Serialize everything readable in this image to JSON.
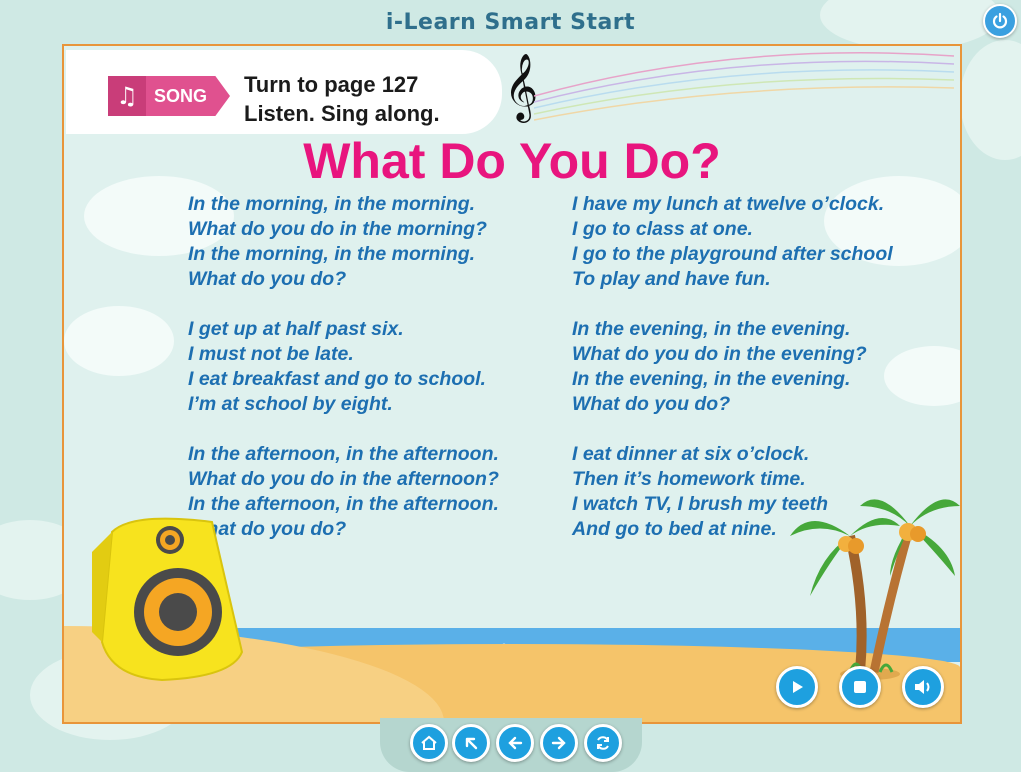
{
  "app": {
    "title": "i-Learn Smart Start"
  },
  "banner": {
    "tag_label": "SONG",
    "instruction_line1": "Turn to page 127",
    "instruction_line2": "Listen. Sing along."
  },
  "song": {
    "title": "What Do You Do?",
    "left_column": [
      [
        "In the morning, in the morning.",
        "What do you do in the morning?",
        "In the morning, in the morning.",
        "What do you do?"
      ],
      [
        "I get up at half past six.",
        "I must not be late.",
        "I eat breakfast and go to school.",
        "I’m at school by eight."
      ],
      [
        "In the afternoon, in the afternoon.",
        "What do you do in the afternoon?",
        "In the afternoon, in the afternoon.",
        "What do you do?"
      ]
    ],
    "right_column": [
      [
        "I have my lunch at twelve o’clock.",
        "I go to class at one.",
        "I go to the playground after school",
        "To play and have fun."
      ],
      [
        "In the evening, in the evening.",
        "What do you do in the evening?",
        "In the evening, in the evening.",
        "What do you do?"
      ],
      [
        "I eat dinner at six o’clock.",
        "Then it’s homework time.",
        "I watch TV, I brush my teeth",
        "And go to bed at nine."
      ]
    ]
  },
  "player_controls": [
    {
      "name": "play-button",
      "icon": "play-icon"
    },
    {
      "name": "stop-button",
      "icon": "stop-icon"
    },
    {
      "name": "volume-button",
      "icon": "volume-icon"
    }
  ],
  "navigation": [
    {
      "name": "home-button",
      "icon": "home-icon"
    },
    {
      "name": "menu-button",
      "icon": "arrow-up-left-icon"
    },
    {
      "name": "previous-button",
      "icon": "arrow-left-icon"
    },
    {
      "name": "next-button",
      "icon": "arrow-right-icon"
    },
    {
      "name": "refresh-button",
      "icon": "refresh-icon"
    }
  ],
  "colors": {
    "accent": "#1ea0df",
    "title": "#e8157e",
    "lyrics": "#1d6fb1",
    "frame": "#e8953a",
    "song_tag": "#e0518f"
  }
}
